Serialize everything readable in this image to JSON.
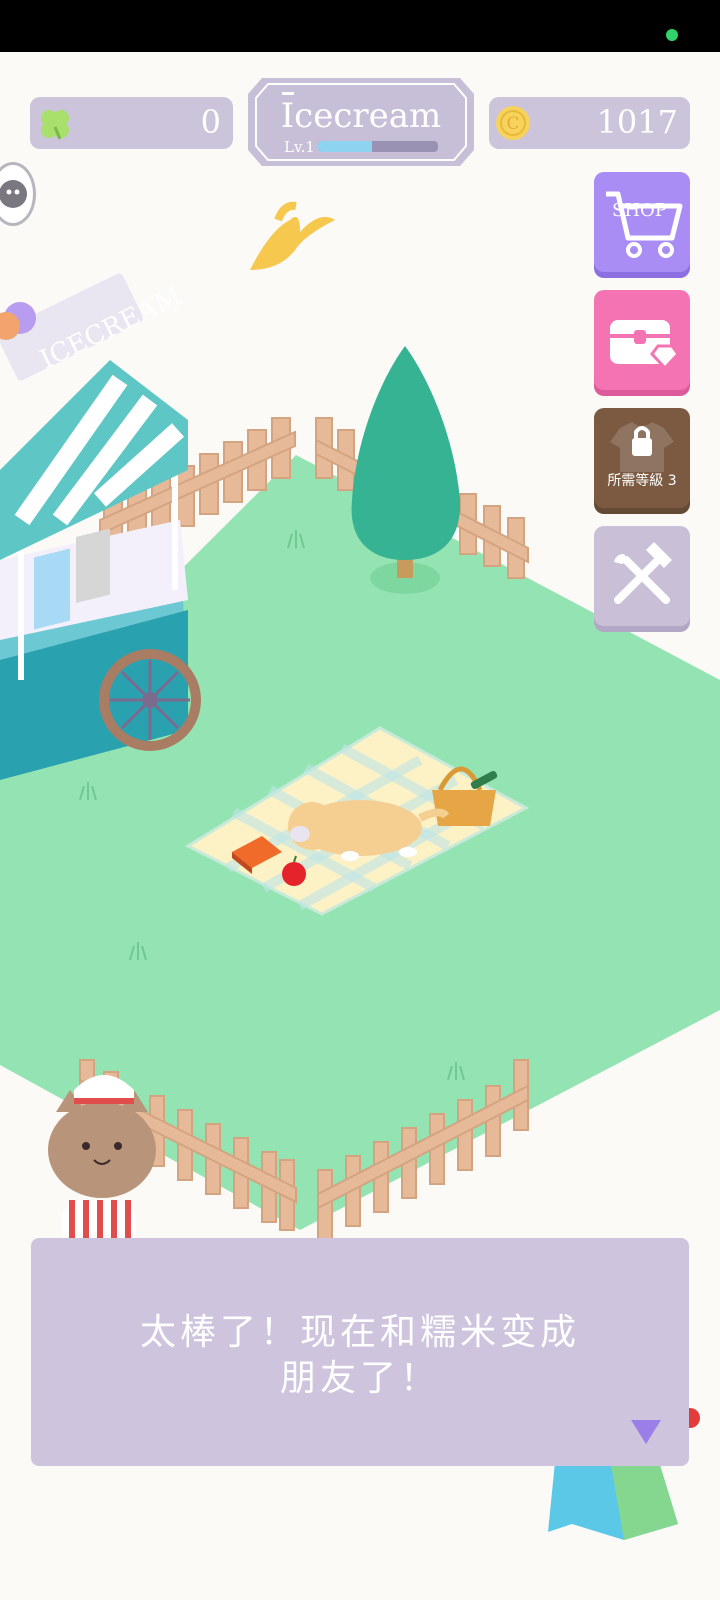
{
  "hud": {
    "clover_count": "0",
    "coin_symbol": "C",
    "coin_count": "1017",
    "shop_title": "Icecream",
    "level_label": "Lv.1",
    "level_progress": 0.45
  },
  "side_menu": {
    "shop_label": "SHOP",
    "locked_item_label": "所需等級 3"
  },
  "stall": {
    "sign_text": "ICECREAM"
  },
  "dialog": {
    "line1": "太棒了！现在和糯米变成",
    "line2": "朋友了！"
  },
  "colors": {
    "grass": "#93e4b2",
    "pill_bg": "#cbc4da",
    "shop_button": "#a98cf4",
    "treasure_button": "#f473b3",
    "locked_button": "#7b5a41",
    "tools_button": "#c9c0d8",
    "dialog_bg": "#cec4dd",
    "accent_arrow": "#9b7ee8"
  }
}
